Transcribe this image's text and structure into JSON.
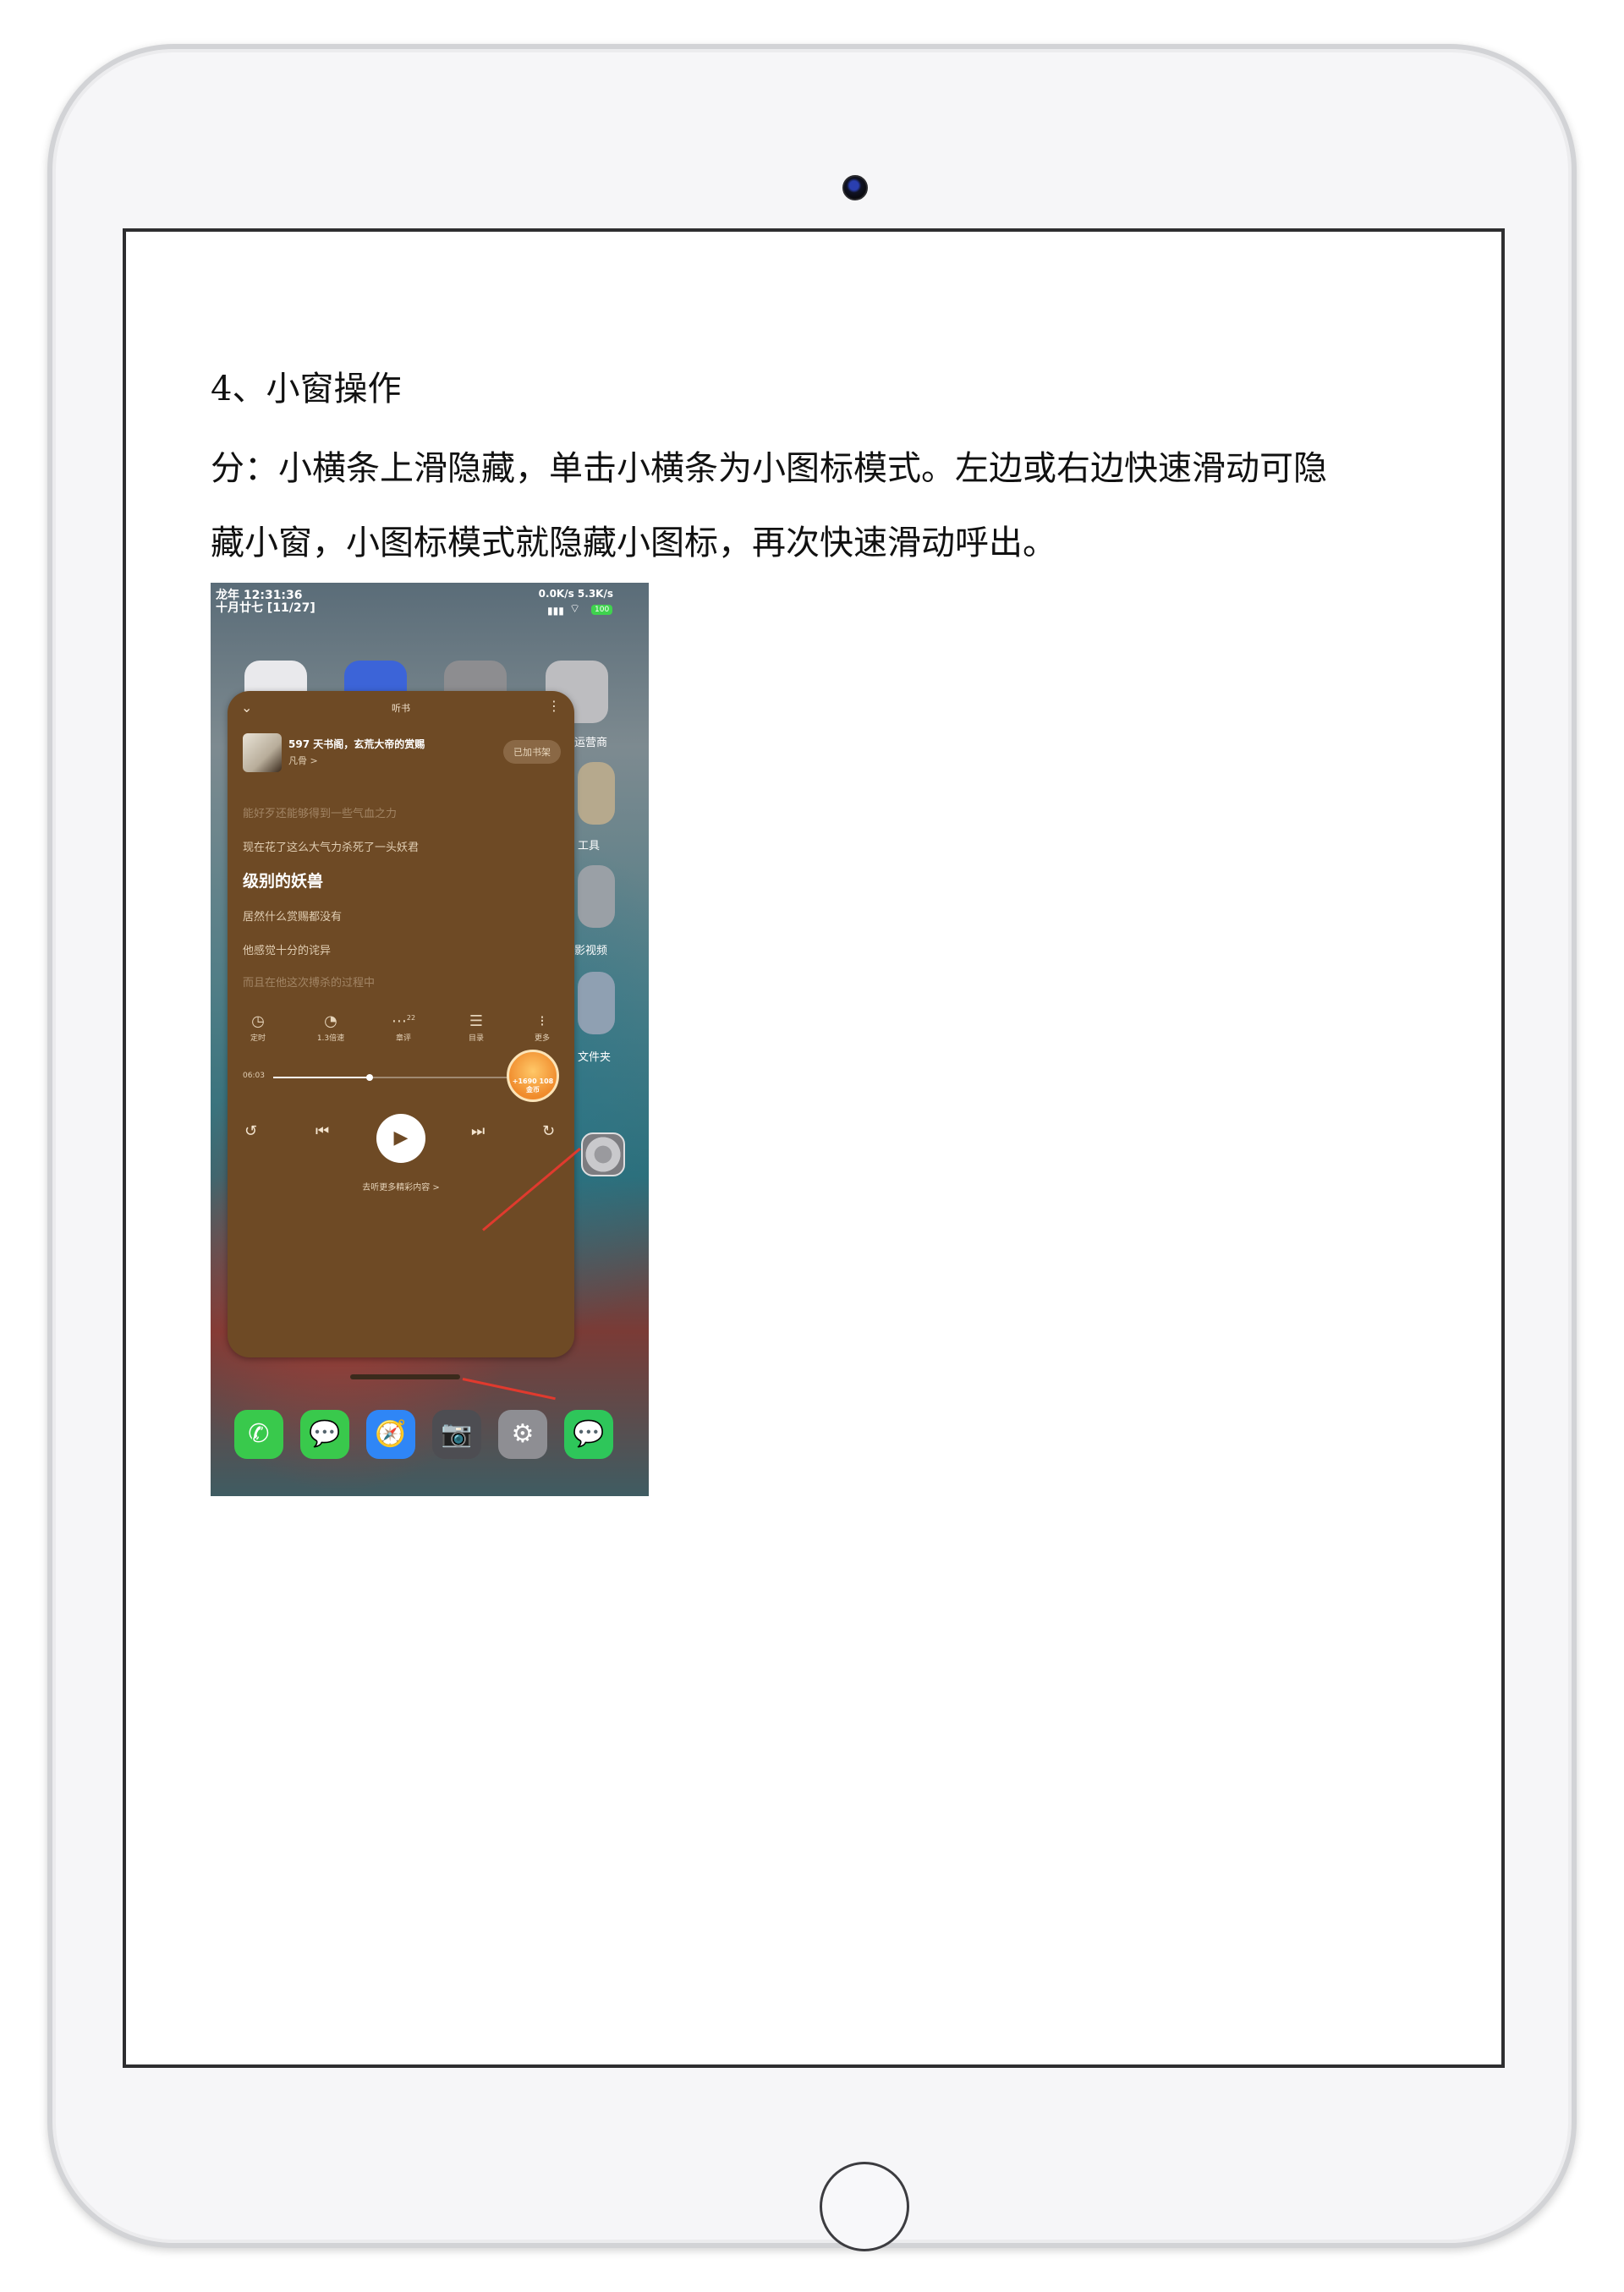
{
  "document": {
    "heading": "4、小窗操作",
    "paragraph_line1": "分：小横条上滑隐藏，单击小横条为小图标模式。左边或右边快速滑动可隐",
    "paragraph_line2": "藏小窗，小图标模式就隐藏小图标，再次快速滑动呼出。"
  },
  "phone": {
    "status_bar": {
      "time": "龙年 12:31:36",
      "date": "十月廿七 [11/27]",
      "net_speed": "0.0K/s 5.3K/s",
      "battery": "100"
    },
    "background_labels": [
      "运营商",
      "工具",
      "影视频",
      "文件夹"
    ],
    "float_window": {
      "title": "听书",
      "book_title": "597 天书阁，玄荒大帝的赏赐",
      "author": "凡骨 >",
      "shelf_button": "已加书架",
      "lyrics": [
        "能好歹还能够得到一些气血之力",
        "现在花了这么大气力杀死了一头妖君",
        "级别的妖兽",
        "居然什么赏赐都没有",
        "他感觉十分的诧异",
        "而且在他这次搏杀的过程中"
      ],
      "tools": [
        {
          "label": "定时",
          "icon": "timer-icon"
        },
        {
          "label": "1.3倍速",
          "icon": "speed-icon"
        },
        {
          "label": "章评",
          "icon": "comment-icon"
        },
        {
          "label": "目录",
          "icon": "catalog-icon"
        },
        {
          "label": "更多",
          "icon": "more-icon"
        }
      ],
      "comment_count": "22",
      "progress_time": "06:03",
      "progress_fraction": 0.38,
      "coin_badge": "+1690 108金币",
      "more_content": "去听更多精彩内容 >"
    },
    "dock_apps": [
      {
        "name": "phone-app-icon",
        "glyph": "✆",
        "color": "#39c94c"
      },
      {
        "name": "messages-app-icon",
        "glyph": "💬",
        "color": "#39c94c"
      },
      {
        "name": "safari-app-icon",
        "glyph": "🧭",
        "color": "#2f86f6"
      },
      {
        "name": "camera-app-icon",
        "glyph": "📷",
        "color": "#4d4d52"
      },
      {
        "name": "settings-app-icon",
        "glyph": "⚙",
        "color": "#8e8e93"
      },
      {
        "name": "wechat-app-icon",
        "glyph": "💬",
        "color": "#2ec65a"
      }
    ]
  }
}
